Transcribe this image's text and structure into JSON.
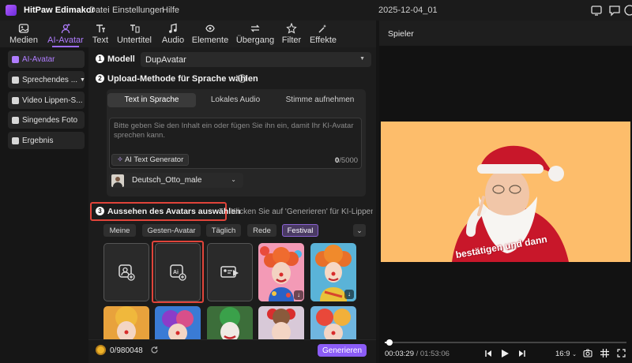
{
  "titlebar": {
    "app_title": "HitPaw Edimakor",
    "menus": [
      "Datei",
      "Einstellungen",
      "Hilfe"
    ],
    "project_name": "2025-12-04_01",
    "icons": [
      "monitor-icon",
      "comment-icon",
      "help-icon",
      "minimize-icon",
      "maximize-icon",
      "close-icon"
    ]
  },
  "toolbar": {
    "items": [
      {
        "label": "Medien",
        "icon": "media-icon"
      },
      {
        "label": "AI-Avatar",
        "icon": "ai-avatar-icon",
        "active": true
      },
      {
        "label": "Text",
        "icon": "text-icon"
      },
      {
        "label": "Untertitel",
        "icon": "subtitle-icon"
      },
      {
        "label": "Audio",
        "icon": "audio-icon"
      },
      {
        "label": "Elemente",
        "icon": "elements-icon"
      },
      {
        "label": "Übergang",
        "icon": "transition-icon"
      },
      {
        "label": "Filter",
        "icon": "filter-icon"
      },
      {
        "label": "Effekte",
        "icon": "effects-icon"
      }
    ]
  },
  "sidebar": {
    "items": [
      {
        "label": "AI-Avatar",
        "active": true
      },
      {
        "label": "Sprechendes ..."
      },
      {
        "label": "Video Lippen-S..."
      },
      {
        "label": "Singendes Foto"
      },
      {
        "label": "Ergebnis"
      }
    ]
  },
  "step1": {
    "number": "1",
    "label": "Modell",
    "model_value": "DupAvatar"
  },
  "step2": {
    "number": "2",
    "label": "Upload-Methode für Sprache wählen",
    "tabs": [
      "Text in Sprache",
      "Lokales Audio",
      "Stimme aufnehmen"
    ],
    "active_tab": 0,
    "textarea_placeholder": "Bitte geben Sie den Inhalt ein oder fügen Sie ihn ein, damit Ihr KI-Avatar sprechen kann.",
    "ai_text_generator": "AI Text Generator",
    "char_count": "0",
    "char_limit": "/5000",
    "voice": "Deutsch_Otto_male"
  },
  "step3": {
    "number": "3",
    "label": "Aussehen des Avatars auswählen",
    "hint": "Klicken Sie auf 'Generieren' für KI-Lippen...",
    "filters": [
      "Meine",
      "Gesten-Avatar",
      "Täglich",
      "Rede",
      "Festival"
    ],
    "active_filter": "Festival"
  },
  "footer": {
    "credits": "0/980048",
    "generate": "Generieren"
  },
  "player": {
    "title": "Spieler",
    "overlay_text": "bestätigen und dann",
    "time_current": "00:03:29",
    "time_total": "/ 01:53:06",
    "aspect": "16:9",
    "progress": 0.02
  },
  "colors": {
    "accent": "#8b5cf6",
    "highlight_red": "#e0443a",
    "preview_bg": "#fdbd6b"
  }
}
